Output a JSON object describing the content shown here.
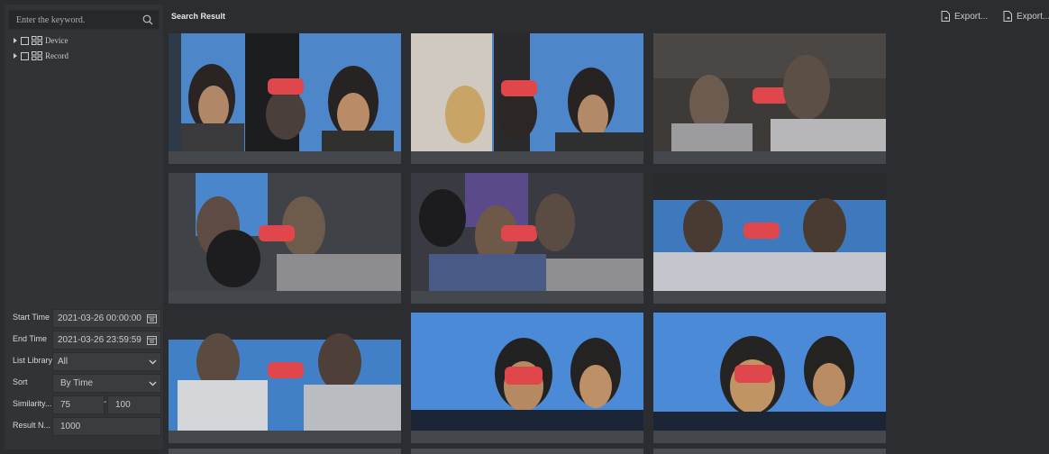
{
  "search": {
    "placeholder": "Enter the keyword."
  },
  "tree": [
    {
      "label": "Device"
    },
    {
      "label": "Record"
    }
  ],
  "filters": {
    "start_time": {
      "label": "Start Time",
      "value": "2021-03-26 00:00:00"
    },
    "end_time": {
      "label": "End Time",
      "value": "2021-03-26 23:59:59"
    },
    "list_library": {
      "label": "List Library",
      "value": "All"
    },
    "sort": {
      "label": "Sort",
      "value": "By Time"
    },
    "similarity": {
      "label": "Similarity...",
      "from": "75",
      "dash": "-",
      "to": "100"
    },
    "result_n": {
      "label": "Result N...",
      "value": "1000"
    }
  },
  "main": {
    "title": "Search Result",
    "export_1": "Export...",
    "export_2": "Export..."
  },
  "results": [
    {
      "scene": "two-faces-blue"
    },
    {
      "scene": "three-faces-white"
    },
    {
      "scene": "two-faces-dark"
    },
    {
      "scene": "group-blue-left"
    },
    {
      "scene": "group-purple"
    },
    {
      "scene": "two-faces-bright"
    },
    {
      "scene": "crowd-white"
    },
    {
      "scene": "faces-blue-sky"
    },
    {
      "scene": "faces-blue-sky-2"
    }
  ],
  "colors": {
    "accent_red": "#e0474c",
    "panel_bg": "#313336",
    "page_bg": "#2b2d30"
  }
}
